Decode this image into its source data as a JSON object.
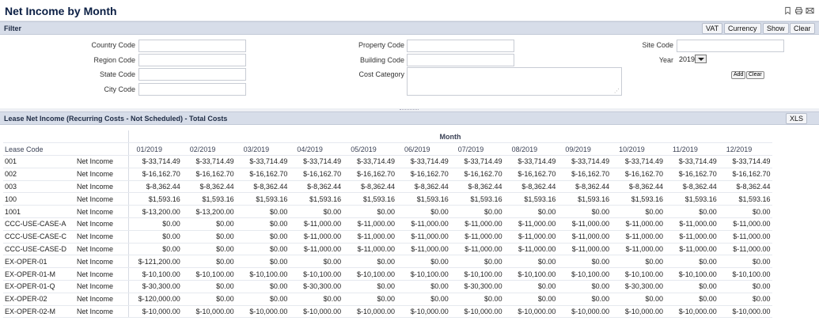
{
  "page": {
    "title": "Net Income by Month"
  },
  "filter": {
    "title": "Filter",
    "buttons": {
      "vat": "VAT",
      "currency": "Currency",
      "show": "Show",
      "clear": "Clear"
    },
    "fields": {
      "country_code": "Country Code",
      "region_code": "Region Code",
      "state_code": "State Code",
      "city_code": "City Code",
      "property_code": "Property Code",
      "building_code": "Building Code",
      "cost_category": "Cost Category",
      "site_code": "Site Code",
      "year": "Year"
    },
    "year_value": "2019",
    "add_label": "Add",
    "clear_small_label": "Clear"
  },
  "grid": {
    "title": "Lease Net Income (Recurring Costs - Not Scheduled) - Total Costs",
    "xls_label": "XLS",
    "group_header": "Month",
    "lease_code_header": "Lease Code",
    "months": [
      "01/2019",
      "02/2019",
      "03/2019",
      "04/2019",
      "05/2019",
      "06/2019",
      "07/2019",
      "08/2019",
      "09/2019",
      "10/2019",
      "11/2019",
      "12/2019"
    ],
    "rows": [
      {
        "code": "001",
        "type": "Net Income",
        "values": [
          "$-33,714.49",
          "$-33,714.49",
          "$-33,714.49",
          "$-33,714.49",
          "$-33,714.49",
          "$-33,714.49",
          "$-33,714.49",
          "$-33,714.49",
          "$-33,714.49",
          "$-33,714.49",
          "$-33,714.49",
          "$-33,714.49"
        ]
      },
      {
        "code": "002",
        "type": "Net Income",
        "values": [
          "$-16,162.70",
          "$-16,162.70",
          "$-16,162.70",
          "$-16,162.70",
          "$-16,162.70",
          "$-16,162.70",
          "$-16,162.70",
          "$-16,162.70",
          "$-16,162.70",
          "$-16,162.70",
          "$-16,162.70",
          "$-16,162.70"
        ]
      },
      {
        "code": "003",
        "type": "Net Income",
        "values": [
          "$-8,362.44",
          "$-8,362.44",
          "$-8,362.44",
          "$-8,362.44",
          "$-8,362.44",
          "$-8,362.44",
          "$-8,362.44",
          "$-8,362.44",
          "$-8,362.44",
          "$-8,362.44",
          "$-8,362.44",
          "$-8,362.44"
        ]
      },
      {
        "code": "100",
        "type": "Net Income",
        "values": [
          "$1,593.16",
          "$1,593.16",
          "$1,593.16",
          "$1,593.16",
          "$1,593.16",
          "$1,593.16",
          "$1,593.16",
          "$1,593.16",
          "$1,593.16",
          "$1,593.16",
          "$1,593.16",
          "$1,593.16"
        ]
      },
      {
        "code": "1001",
        "type": "Net Income",
        "values": [
          "$-13,200.00",
          "$-13,200.00",
          "$0.00",
          "$0.00",
          "$0.00",
          "$0.00",
          "$0.00",
          "$0.00",
          "$0.00",
          "$0.00",
          "$0.00",
          "$0.00"
        ]
      },
      {
        "code": "CCC-USE-CASE-A",
        "type": "Net Income",
        "values": [
          "$0.00",
          "$0.00",
          "$0.00",
          "$-11,000.00",
          "$-11,000.00",
          "$-11,000.00",
          "$-11,000.00",
          "$-11,000.00",
          "$-11,000.00",
          "$-11,000.00",
          "$-11,000.00",
          "$-11,000.00"
        ]
      },
      {
        "code": "CCC-USE-CASE-C",
        "type": "Net Income",
        "values": [
          "$0.00",
          "$0.00",
          "$0.00",
          "$-11,000.00",
          "$-11,000.00",
          "$-11,000.00",
          "$-11,000.00",
          "$-11,000.00",
          "$-11,000.00",
          "$-11,000.00",
          "$-11,000.00",
          "$-11,000.00"
        ]
      },
      {
        "code": "CCC-USE-CASE-D",
        "type": "Net Income",
        "values": [
          "$0.00",
          "$0.00",
          "$0.00",
          "$-11,000.00",
          "$-11,000.00",
          "$-11,000.00",
          "$-11,000.00",
          "$-11,000.00",
          "$-11,000.00",
          "$-11,000.00",
          "$-11,000.00",
          "$-11,000.00"
        ]
      },
      {
        "code": "EX-OPER-01",
        "type": "Net Income",
        "values": [
          "$-121,200.00",
          "$0.00",
          "$0.00",
          "$0.00",
          "$0.00",
          "$0.00",
          "$0.00",
          "$0.00",
          "$0.00",
          "$0.00",
          "$0.00",
          "$0.00"
        ]
      },
      {
        "code": "EX-OPER-01-M",
        "type": "Net Income",
        "values": [
          "$-10,100.00",
          "$-10,100.00",
          "$-10,100.00",
          "$-10,100.00",
          "$-10,100.00",
          "$-10,100.00",
          "$-10,100.00",
          "$-10,100.00",
          "$-10,100.00",
          "$-10,100.00",
          "$-10,100.00",
          "$-10,100.00"
        ]
      },
      {
        "code": "EX-OPER-01-Q",
        "type": "Net Income",
        "values": [
          "$-30,300.00",
          "$0.00",
          "$0.00",
          "$-30,300.00",
          "$0.00",
          "$0.00",
          "$-30,300.00",
          "$0.00",
          "$0.00",
          "$-30,300.00",
          "$0.00",
          "$0.00"
        ]
      },
      {
        "code": "EX-OPER-02",
        "type": "Net Income",
        "values": [
          "$-120,000.00",
          "$0.00",
          "$0.00",
          "$0.00",
          "$0.00",
          "$0.00",
          "$0.00",
          "$0.00",
          "$0.00",
          "$0.00",
          "$0.00",
          "$0.00"
        ]
      },
      {
        "code": "EX-OPER-02-M",
        "type": "Net Income",
        "values": [
          "$-10,000.00",
          "$-10,000.00",
          "$-10,000.00",
          "$-10,000.00",
          "$-10,000.00",
          "$-10,000.00",
          "$-10,000.00",
          "$-10,000.00",
          "$-10,000.00",
          "$-10,000.00",
          "$-10,000.00",
          "$-10,000.00"
        ]
      }
    ]
  }
}
